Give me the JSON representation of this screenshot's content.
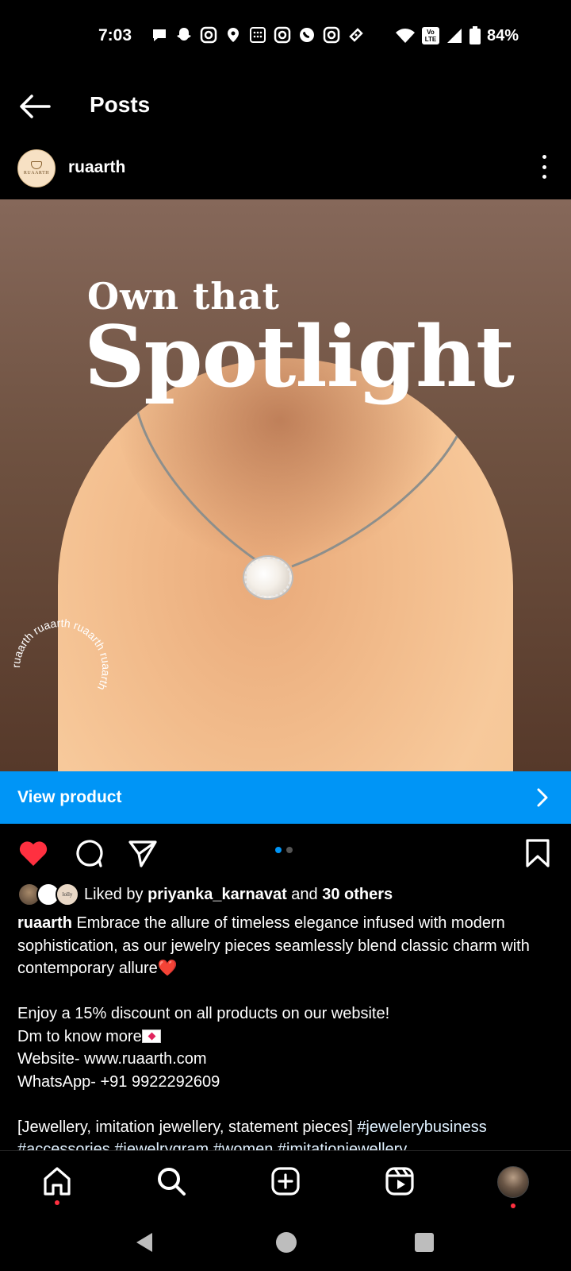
{
  "status_bar": {
    "time": "7:03",
    "battery": "84%",
    "icons": [
      "chat-icon",
      "snapchat-icon",
      "instagram-icon",
      "location-icon",
      "calculator-icon",
      "instagram-icon",
      "whatsapp-icon",
      "instagram-icon",
      "ticket-icon",
      "wifi-icon",
      "volte-icon",
      "signal-icon",
      "battery-icon"
    ],
    "volte_label": "Vo LTE"
  },
  "header": {
    "title": "Posts"
  },
  "post": {
    "username": "ruaarth",
    "avatar_text": "RUAARTH",
    "media": {
      "line1": "Own that",
      "line2": "Spotlight",
      "stamp_text": "ruaarth ruaarth ruaarth ruaarth "
    },
    "view_product_label": "View product",
    "carousel": {
      "count": 2,
      "active": 1
    },
    "likes": {
      "prefix": "Liked by ",
      "user": "priyanka_karnavat",
      "middle": " and ",
      "others": "30 others",
      "avatar3_text": "lolly"
    },
    "caption": {
      "user": "ruaarth",
      "text1": " Embrace the allure of timeless elegance infused with modern sophistication, as our jewelry pieces seamlessly blend classic charm with contemporary allure",
      "heart": "❤️",
      "line2": "Enjoy a 15% discount on all products on our website!",
      "line3": "Dm to know more",
      "line4": "Website- www.ruaarth.com",
      "line5": "WhatsApp- +91 9922292609",
      "line6_text": "[Jewellery, imitation jewellery, statement pieces] ",
      "line6_tag": "#jewelerybusiness",
      "line7": "#accessories #jewelrygram #women #imitationjewellery"
    }
  },
  "colors": {
    "accent": "#0095f6",
    "like_red": "#ff3040",
    "background": "#000000"
  },
  "bottom_nav": [
    "home-icon",
    "search-icon",
    "create-icon",
    "reels-icon",
    "profile-avatar"
  ],
  "system_nav": [
    "back-triangle",
    "home-circle",
    "recents-square"
  ]
}
